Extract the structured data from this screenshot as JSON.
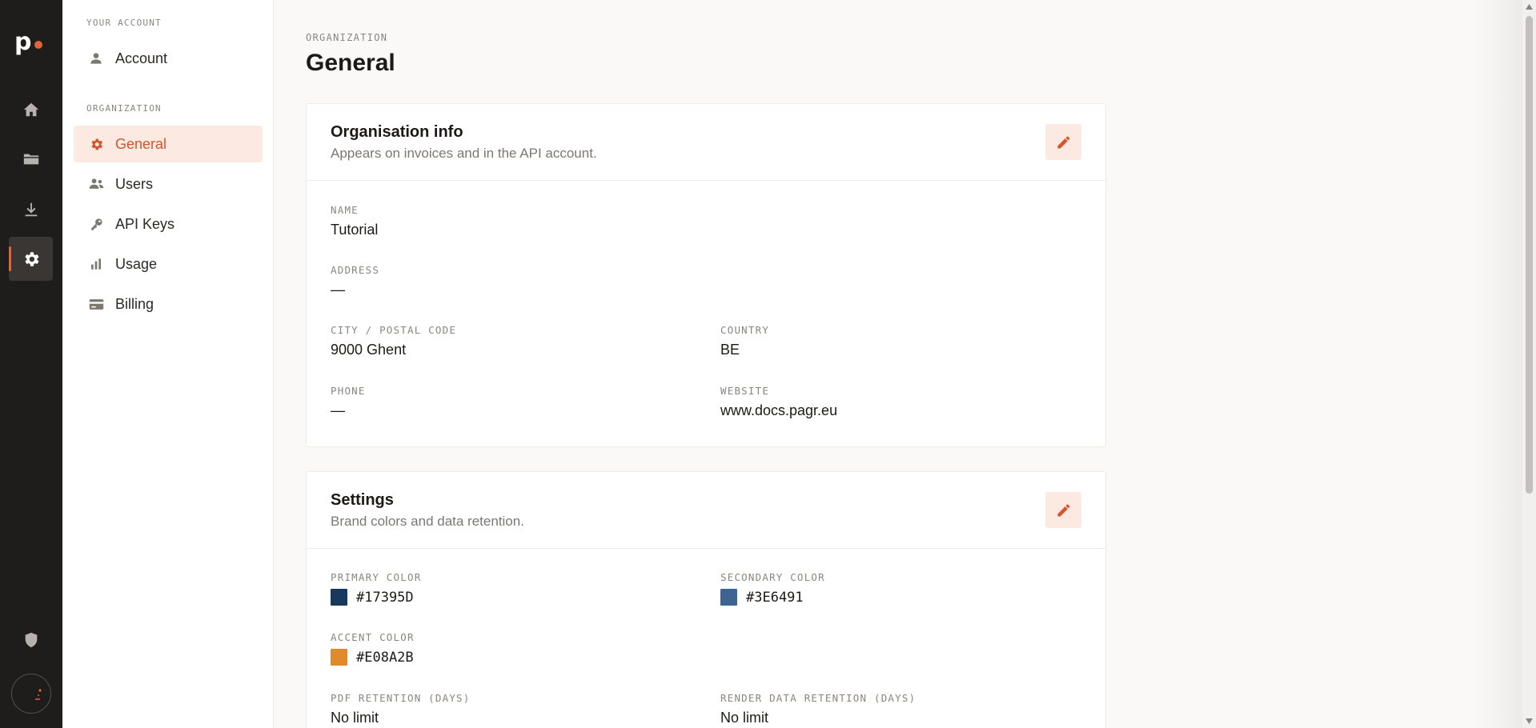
{
  "rail": {
    "logo_text": "p",
    "icons": [
      "home-icon",
      "folder-icon",
      "download-icon",
      "settings-icon",
      "shield-icon"
    ]
  },
  "sidebar": {
    "sections": [
      {
        "label": "YOUR ACCOUNT",
        "items": [
          {
            "label": "Account",
            "icon": "person-icon"
          }
        ]
      },
      {
        "label": "ORGANIZATION",
        "items": [
          {
            "label": "General",
            "icon": "gear-icon",
            "active": true
          },
          {
            "label": "Users",
            "icon": "users-icon"
          },
          {
            "label": "API Keys",
            "icon": "key-icon"
          },
          {
            "label": "Usage",
            "icon": "bar-chart-icon"
          },
          {
            "label": "Billing",
            "icon": "credit-card-icon"
          }
        ]
      }
    ]
  },
  "header": {
    "eyebrow": "ORGANIZATION",
    "title": "General"
  },
  "org_info": {
    "title": "Organisation info",
    "subtitle": "Appears on invoices and in the API account.",
    "fields": {
      "name": {
        "label": "NAME",
        "value": "Tutorial"
      },
      "address": {
        "label": "ADDRESS",
        "value": "—"
      },
      "city": {
        "label": "CITY / POSTAL CODE",
        "value": "9000 Ghent"
      },
      "country": {
        "label": "COUNTRY",
        "value": "BE"
      },
      "phone": {
        "label": "PHONE",
        "value": "—"
      },
      "website": {
        "label": "WEBSITE",
        "value": "www.docs.pagr.eu"
      }
    }
  },
  "settings": {
    "title": "Settings",
    "subtitle": "Brand colors and data retention.",
    "fields": {
      "primary": {
        "label": "PRIMARY COLOR",
        "value": "#17395D",
        "color": "#17395D"
      },
      "secondary": {
        "label": "SECONDARY COLOR",
        "value": "#3E6491",
        "color": "#3E6491"
      },
      "accent": {
        "label": "ACCENT COLOR",
        "value": "#E08A2B",
        "color": "#E08A2B"
      },
      "pdf_retention": {
        "label": "PDF RETENTION (DAYS)",
        "value": "No limit"
      },
      "render_retention": {
        "label": "RENDER DATA RETENTION (DAYS)",
        "value": "No limit"
      }
    }
  },
  "colors": {
    "accent": "#D4542B",
    "accent_bg": "#FCE9E2",
    "rail_bg": "#1F1D1B"
  }
}
